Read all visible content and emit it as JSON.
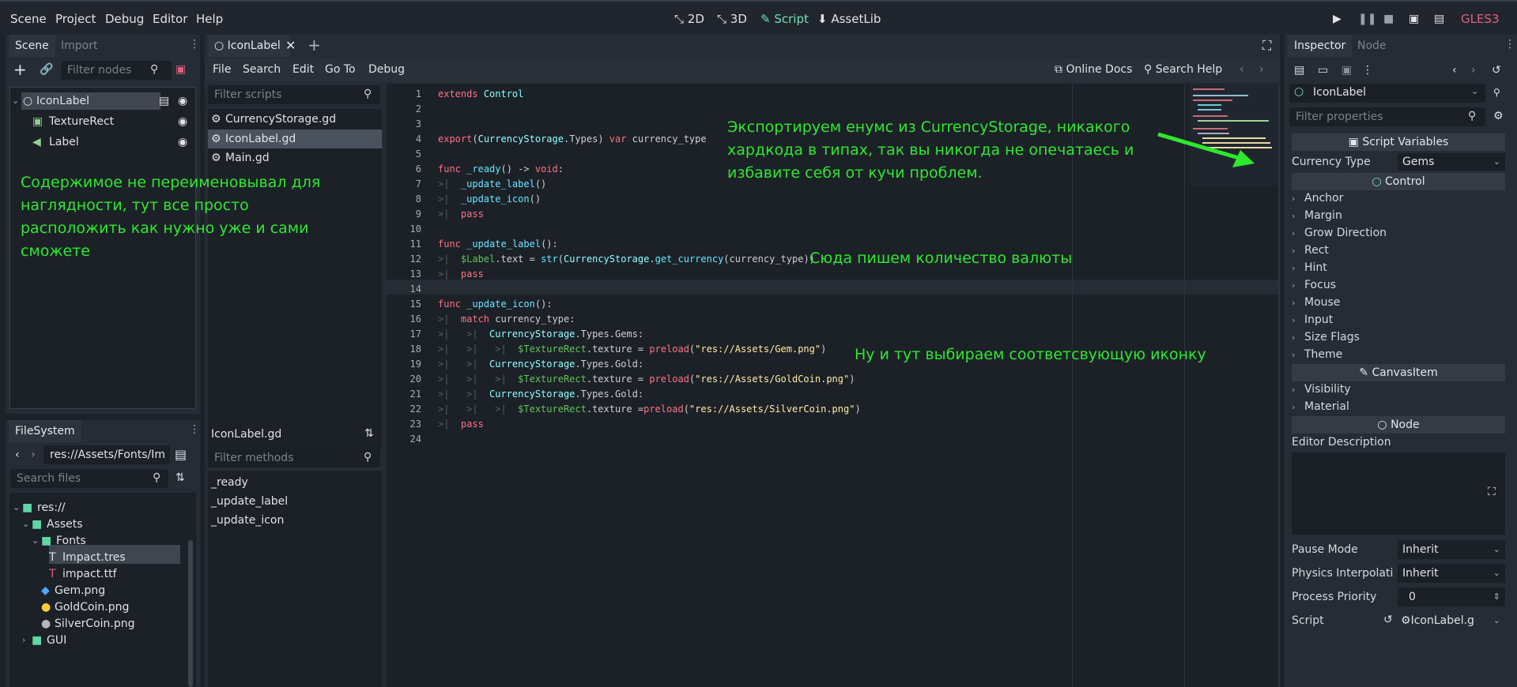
{
  "menu": [
    "Scene",
    "Project",
    "Debug",
    "Editor",
    "Help"
  ],
  "modes": [
    {
      "icon": "⤡",
      "label": "2D"
    },
    {
      "icon": "⤡",
      "label": "3D"
    },
    {
      "icon": "✎",
      "label": "Script"
    },
    {
      "icon": "⬇",
      "label": "AssetLib"
    }
  ],
  "renderer": "GLES3",
  "scene_dock": {
    "tabs": [
      "Scene",
      "Import"
    ],
    "filter_placeholder": "Filter nodes",
    "nodes": [
      "IconLabel",
      "TextureRect",
      "Label"
    ]
  },
  "filesystem": {
    "tab": "FileSystem",
    "path": "res://Assets/Fonts/Im",
    "search_placeholder": "Search files",
    "items": [
      "res://",
      "Assets",
      "Fonts",
      "Impact.tres",
      "impact.ttf",
      "Gem.png",
      "GoldCoin.png",
      "SilverCoin.png",
      "GUI"
    ]
  },
  "script_editor": {
    "tab": "IconLabel",
    "menu": [
      "File",
      "Search",
      "Edit",
      "Go To",
      "Debug"
    ],
    "online_docs": "Online Docs",
    "search_help": "Search Help",
    "filter_scripts_placeholder": "Filter scripts",
    "scripts": [
      "CurrencyStorage.gd",
      "IconLabel.gd",
      "Main.gd"
    ],
    "current_script": "IconLabel.gd",
    "filter_methods_placeholder": "Filter methods",
    "methods": [
      "_ready",
      "_update_label",
      "_update_icon"
    ],
    "line_numbers": [
      "1",
      "2",
      "3",
      "4",
      "5",
      "6",
      "7",
      "8",
      "9",
      "10",
      "11",
      "12",
      "13",
      "14",
      "15",
      "16",
      "17",
      "18",
      "19",
      "20",
      "21",
      "22",
      "23",
      "24"
    ]
  },
  "annotations": {
    "left": "Содержимое не переименовывал для наглядности, тут все просто расположить как нужно уже и сами сможете",
    "top": "Экспортируем енумс из CurrencyStorage, никакого хардкода в типах, так вы никогда не опечатаесь и избавите себя от кучи проблем.",
    "mid": "Сюда пишем количество валюты",
    "bottom": "Ну и тут выбираем соответсвующую иконку"
  },
  "inspector": {
    "tabs": [
      "Inspector",
      "Node"
    ],
    "object": "IconLabel",
    "filter_placeholder": "Filter properties",
    "script_variables": "Script Variables",
    "currency_type_label": "Currency Type",
    "currency_type_value": "Gems",
    "control_header": "Control",
    "control_groups": [
      "Anchor",
      "Margin",
      "Grow Direction",
      "Rect",
      "Hint",
      "Focus",
      "Mouse",
      "Input",
      "Size Flags",
      "Theme"
    ],
    "canvas_header": "CanvasItem",
    "canvas_groups": [
      "Visibility",
      "Material"
    ],
    "node_header": "Node",
    "editor_description": "Editor Description",
    "pause_mode_label": "Pause Mode",
    "pause_mode_value": "Inherit",
    "physics_label": "Physics Interpolati",
    "physics_value": "Inherit",
    "priority_label": "Process Priority",
    "priority_value": "0",
    "script_label": "Script",
    "script_value": "IconLabel.g"
  },
  "colors": {
    "accent": "#6fe2b4",
    "annotation": "#2ee82e",
    "renderer": "#e0607e"
  }
}
